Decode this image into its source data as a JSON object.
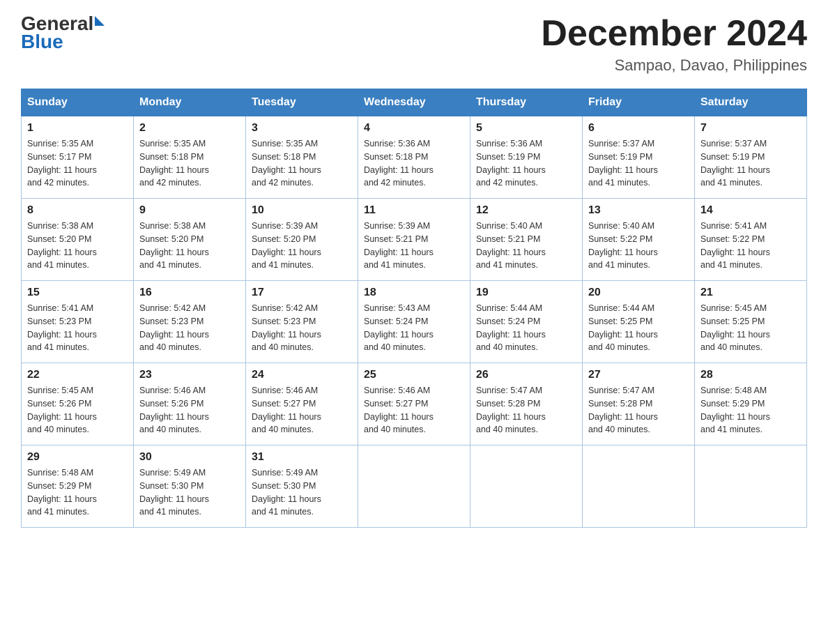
{
  "header": {
    "logo_general": "General",
    "logo_blue": "Blue",
    "month_title": "December 2024",
    "location": "Sampao, Davao, Philippines"
  },
  "days_of_week": [
    "Sunday",
    "Monday",
    "Tuesday",
    "Wednesday",
    "Thursday",
    "Friday",
    "Saturday"
  ],
  "weeks": [
    [
      {
        "day": "1",
        "sunrise": "5:35 AM",
        "sunset": "5:17 PM",
        "daylight": "11 hours and 42 minutes."
      },
      {
        "day": "2",
        "sunrise": "5:35 AM",
        "sunset": "5:18 PM",
        "daylight": "11 hours and 42 minutes."
      },
      {
        "day": "3",
        "sunrise": "5:35 AM",
        "sunset": "5:18 PM",
        "daylight": "11 hours and 42 minutes."
      },
      {
        "day": "4",
        "sunrise": "5:36 AM",
        "sunset": "5:18 PM",
        "daylight": "11 hours and 42 minutes."
      },
      {
        "day": "5",
        "sunrise": "5:36 AM",
        "sunset": "5:19 PM",
        "daylight": "11 hours and 42 minutes."
      },
      {
        "day": "6",
        "sunrise": "5:37 AM",
        "sunset": "5:19 PM",
        "daylight": "11 hours and 41 minutes."
      },
      {
        "day": "7",
        "sunrise": "5:37 AM",
        "sunset": "5:19 PM",
        "daylight": "11 hours and 41 minutes."
      }
    ],
    [
      {
        "day": "8",
        "sunrise": "5:38 AM",
        "sunset": "5:20 PM",
        "daylight": "11 hours and 41 minutes."
      },
      {
        "day": "9",
        "sunrise": "5:38 AM",
        "sunset": "5:20 PM",
        "daylight": "11 hours and 41 minutes."
      },
      {
        "day": "10",
        "sunrise": "5:39 AM",
        "sunset": "5:20 PM",
        "daylight": "11 hours and 41 minutes."
      },
      {
        "day": "11",
        "sunrise": "5:39 AM",
        "sunset": "5:21 PM",
        "daylight": "11 hours and 41 minutes."
      },
      {
        "day": "12",
        "sunrise": "5:40 AM",
        "sunset": "5:21 PM",
        "daylight": "11 hours and 41 minutes."
      },
      {
        "day": "13",
        "sunrise": "5:40 AM",
        "sunset": "5:22 PM",
        "daylight": "11 hours and 41 minutes."
      },
      {
        "day": "14",
        "sunrise": "5:41 AM",
        "sunset": "5:22 PM",
        "daylight": "11 hours and 41 minutes."
      }
    ],
    [
      {
        "day": "15",
        "sunrise": "5:41 AM",
        "sunset": "5:23 PM",
        "daylight": "11 hours and 41 minutes."
      },
      {
        "day": "16",
        "sunrise": "5:42 AM",
        "sunset": "5:23 PM",
        "daylight": "11 hours and 40 minutes."
      },
      {
        "day": "17",
        "sunrise": "5:42 AM",
        "sunset": "5:23 PM",
        "daylight": "11 hours and 40 minutes."
      },
      {
        "day": "18",
        "sunrise": "5:43 AM",
        "sunset": "5:24 PM",
        "daylight": "11 hours and 40 minutes."
      },
      {
        "day": "19",
        "sunrise": "5:44 AM",
        "sunset": "5:24 PM",
        "daylight": "11 hours and 40 minutes."
      },
      {
        "day": "20",
        "sunrise": "5:44 AM",
        "sunset": "5:25 PM",
        "daylight": "11 hours and 40 minutes."
      },
      {
        "day": "21",
        "sunrise": "5:45 AM",
        "sunset": "5:25 PM",
        "daylight": "11 hours and 40 minutes."
      }
    ],
    [
      {
        "day": "22",
        "sunrise": "5:45 AM",
        "sunset": "5:26 PM",
        "daylight": "11 hours and 40 minutes."
      },
      {
        "day": "23",
        "sunrise": "5:46 AM",
        "sunset": "5:26 PM",
        "daylight": "11 hours and 40 minutes."
      },
      {
        "day": "24",
        "sunrise": "5:46 AM",
        "sunset": "5:27 PM",
        "daylight": "11 hours and 40 minutes."
      },
      {
        "day": "25",
        "sunrise": "5:46 AM",
        "sunset": "5:27 PM",
        "daylight": "11 hours and 40 minutes."
      },
      {
        "day": "26",
        "sunrise": "5:47 AM",
        "sunset": "5:28 PM",
        "daylight": "11 hours and 40 minutes."
      },
      {
        "day": "27",
        "sunrise": "5:47 AM",
        "sunset": "5:28 PM",
        "daylight": "11 hours and 40 minutes."
      },
      {
        "day": "28",
        "sunrise": "5:48 AM",
        "sunset": "5:29 PM",
        "daylight": "11 hours and 41 minutes."
      }
    ],
    [
      {
        "day": "29",
        "sunrise": "5:48 AM",
        "sunset": "5:29 PM",
        "daylight": "11 hours and 41 minutes."
      },
      {
        "day": "30",
        "sunrise": "5:49 AM",
        "sunset": "5:30 PM",
        "daylight": "11 hours and 41 minutes."
      },
      {
        "day": "31",
        "sunrise": "5:49 AM",
        "sunset": "5:30 PM",
        "daylight": "11 hours and 41 minutes."
      },
      null,
      null,
      null,
      null
    ]
  ],
  "labels": {
    "sunrise": "Sunrise:",
    "sunset": "Sunset:",
    "daylight": "Daylight:"
  }
}
